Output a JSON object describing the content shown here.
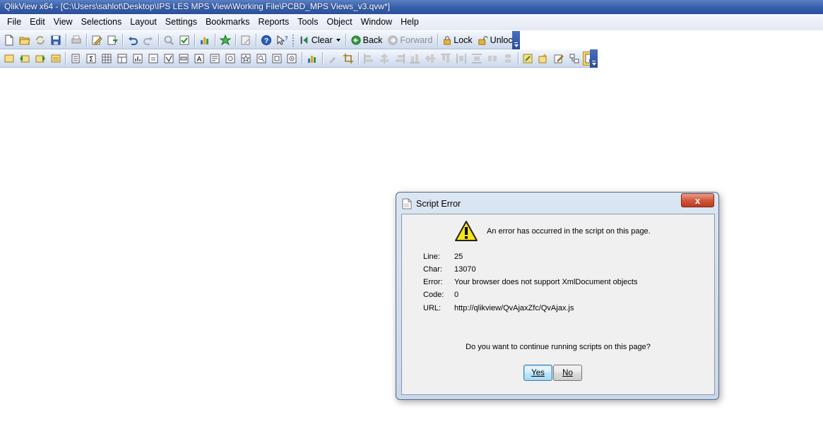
{
  "window": {
    "title": "QlikView x64 - [C:\\Users\\sahlot\\Desktop\\IPS LES MPS View\\Working File\\PCBD_MPS Views_v3.qvw*]"
  },
  "menu": {
    "items": [
      "File",
      "Edit",
      "View",
      "Selections",
      "Layout",
      "Settings",
      "Bookmarks",
      "Reports",
      "Tools",
      "Object",
      "Window",
      "Help"
    ]
  },
  "toolbar1": {
    "clear_label": "Clear",
    "back_label": "Back",
    "forward_label": "Forward",
    "lock_label": "Lock",
    "unlock_label": "Unlock"
  },
  "dialog": {
    "title": "Script Error",
    "close_glyph": "x",
    "headline": "An error has occurred in the script on this page.",
    "details": [
      {
        "label": "Line:",
        "value": "25"
      },
      {
        "label": "Char:",
        "value": "13070"
      },
      {
        "label": "Error:",
        "value": "Your browser does not support XmlDocument objects"
      },
      {
        "label": "Code:",
        "value": "0"
      },
      {
        "label": "URL:",
        "value": "http://qlikview/QvAjaxZfc/QvAjax.js"
      }
    ],
    "question": "Do you want to continue running scripts on this page?",
    "yes_label": "Yes",
    "no_label": "No"
  },
  "colors": {
    "titlebar": "#3b63ae",
    "close_button": "#c0391e",
    "dialog_frame": "#c9d8ea"
  }
}
